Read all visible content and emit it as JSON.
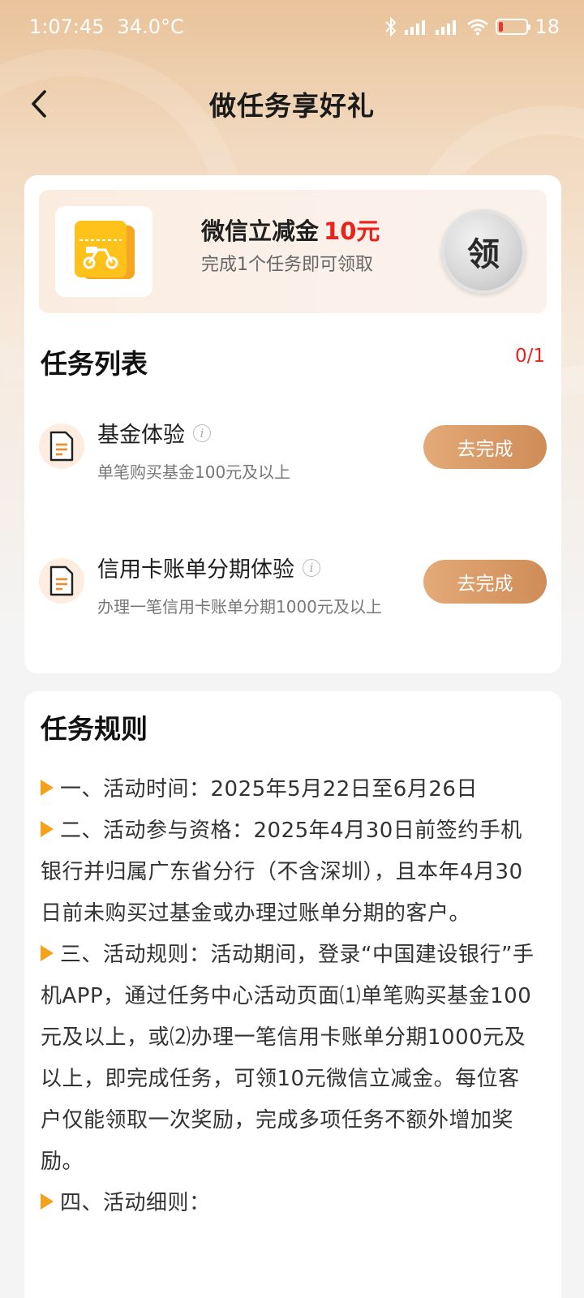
{
  "status_bar": {
    "time": "1:07:45",
    "temperature": "34.0°C",
    "battery": "18"
  },
  "nav": {
    "title": "做任务享好礼"
  },
  "reward": {
    "title": "微信立减金",
    "amount": "10元",
    "desc": "完成1个任务即可领取",
    "claim_label": "领"
  },
  "task_list": {
    "title": "任务列表",
    "count": "0/1",
    "items": [
      {
        "name": "基金体验",
        "desc": "单笔购买基金100元及以上",
        "button": "去完成"
      },
      {
        "name": "信用卡账单分期体验",
        "desc": "办理一笔信用卡账单分期1000元及以上",
        "button": "去完成"
      }
    ]
  },
  "rules": {
    "title": "任务规则",
    "paragraphs": [
      "一、活动时间：2025年5月22日至6月26日",
      "二、活动参与资格：2025年4月30日前签约手机银行并归属广东省分行（不含深圳），且本年4月30日前未购买过基金或办理过账单分期的客户。",
      "三、活动规则：活动期间，登录“中国建设银行”手机APP，通过任务中心活动页面⑴单笔购买基金100元及以上，或⑵办理一笔信用卡账单分期1000元及以上，即完成任务，可领10元微信立减金。每位客户仅能领取一次奖励，完成多项任务不额外增加奖励。",
      "四、活动细则："
    ]
  },
  "colors": {
    "accent_red": "#e8231c",
    "button_orange": "#d9995f",
    "bullet_orange": "#f3a31b"
  }
}
